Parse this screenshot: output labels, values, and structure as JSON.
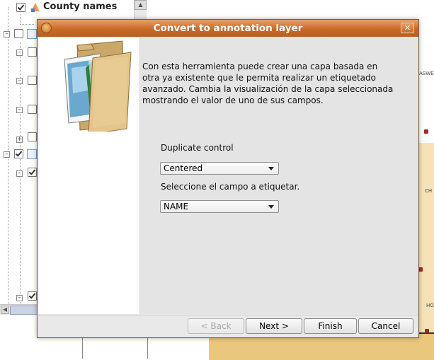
{
  "background": {
    "layer_name": "County names",
    "map_labels": [
      "ASWE",
      "CH",
      "HO"
    ]
  },
  "dialog": {
    "title": "Convert to annotation layer",
    "description": "Con esta herramienta puede crear una capa basada en otra ya existente que le permita realizar un etiquetado avanzado. Cambia la visualización de la capa seleccionada mostrando el valor de uno de sus campos.",
    "duplicate_label": "Duplicate control",
    "duplicate_value": "Centered",
    "field_label": "Seleccione el campo a etiquetar.",
    "field_value": "NAME",
    "buttons": {
      "back": "< Back",
      "next": "Next >",
      "finish": "Finish",
      "cancel": "Cancel"
    },
    "close_symbol": "✕"
  },
  "colors": {
    "titlebar": "#c86a29",
    "dialog_bg": "#e9e9e9",
    "content_bg": "#e4e4e4",
    "map_fill": "#e9c77c"
  }
}
